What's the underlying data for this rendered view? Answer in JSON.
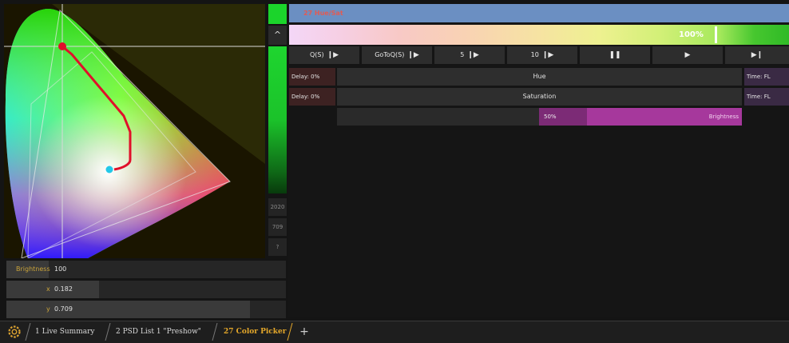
{
  "side_strip": {
    "chevron": "^",
    "buttons": [
      "2020",
      "709",
      "?"
    ]
  },
  "fields": {
    "brightness": {
      "label": "Brightness",
      "value": "100",
      "fill": 0.15
    },
    "x": {
      "label": "x",
      "value": "0.182",
      "fill": 0.33
    },
    "y": {
      "label": "y",
      "value": "0.709",
      "fill": 0.87
    }
  },
  "title": "27 Hue/Sat",
  "intensity": {
    "label": "100%",
    "fraction": 0.85
  },
  "transport": [
    {
      "label": "Q(S)",
      "icon": "play-step-icon"
    },
    {
      "label": "GoToQ(S)",
      "icon": "play-step-icon"
    },
    {
      "label": "5",
      "icon": "play-step-icon"
    },
    {
      "label": "10",
      "icon": "play-step-icon"
    },
    {
      "label": "",
      "icon": "pause-icon"
    },
    {
      "label": "",
      "icon": "play-icon"
    },
    {
      "label": "",
      "icon": "skip-end-icon"
    }
  ],
  "rows": [
    {
      "delay": "Delay: 0%",
      "param": "Hue",
      "time": "Time: FL"
    },
    {
      "delay": "Delay: 0%",
      "param": "Saturation",
      "time": "Time: FL"
    }
  ],
  "brightness_row": {
    "value": "50%",
    "name": "Brightness"
  },
  "tabs": [
    {
      "label": "1 Live Summary",
      "active": false
    },
    {
      "label": "2 PSD List 1 \"Preshow\"",
      "active": false
    },
    {
      "label": "27 Color Picker",
      "active": true
    }
  ],
  "plus": "+",
  "colors": {
    "accent": "#e5a82a",
    "title_bar": "#6b8fc2",
    "brightness_pink": "#a6389c",
    "cursor_red": "#e0102a",
    "cursor_cyan": "#22c8e8"
  }
}
